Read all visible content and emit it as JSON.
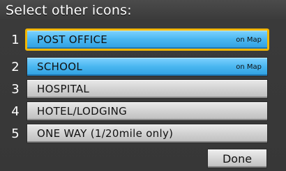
{
  "title": "Select other icons:",
  "rows": [
    {
      "num": "1",
      "label": "POST OFFICE",
      "badge": "on Map"
    },
    {
      "num": "2",
      "label": "SCHOOL",
      "badge": "on Map"
    },
    {
      "num": "3",
      "label": "HOSPITAL",
      "badge": ""
    },
    {
      "num": "4",
      "label": "HOTEL/LODGING",
      "badge": ""
    },
    {
      "num": "5",
      "label": "ONE WAY (1/20mile only)",
      "badge": ""
    }
  ],
  "done_label": "Done",
  "colors": {
    "selected_border": "#f2b600",
    "active_blue": "#49b6f0",
    "button_gray": "#d4d4d4",
    "background": "#3a3a3a"
  }
}
